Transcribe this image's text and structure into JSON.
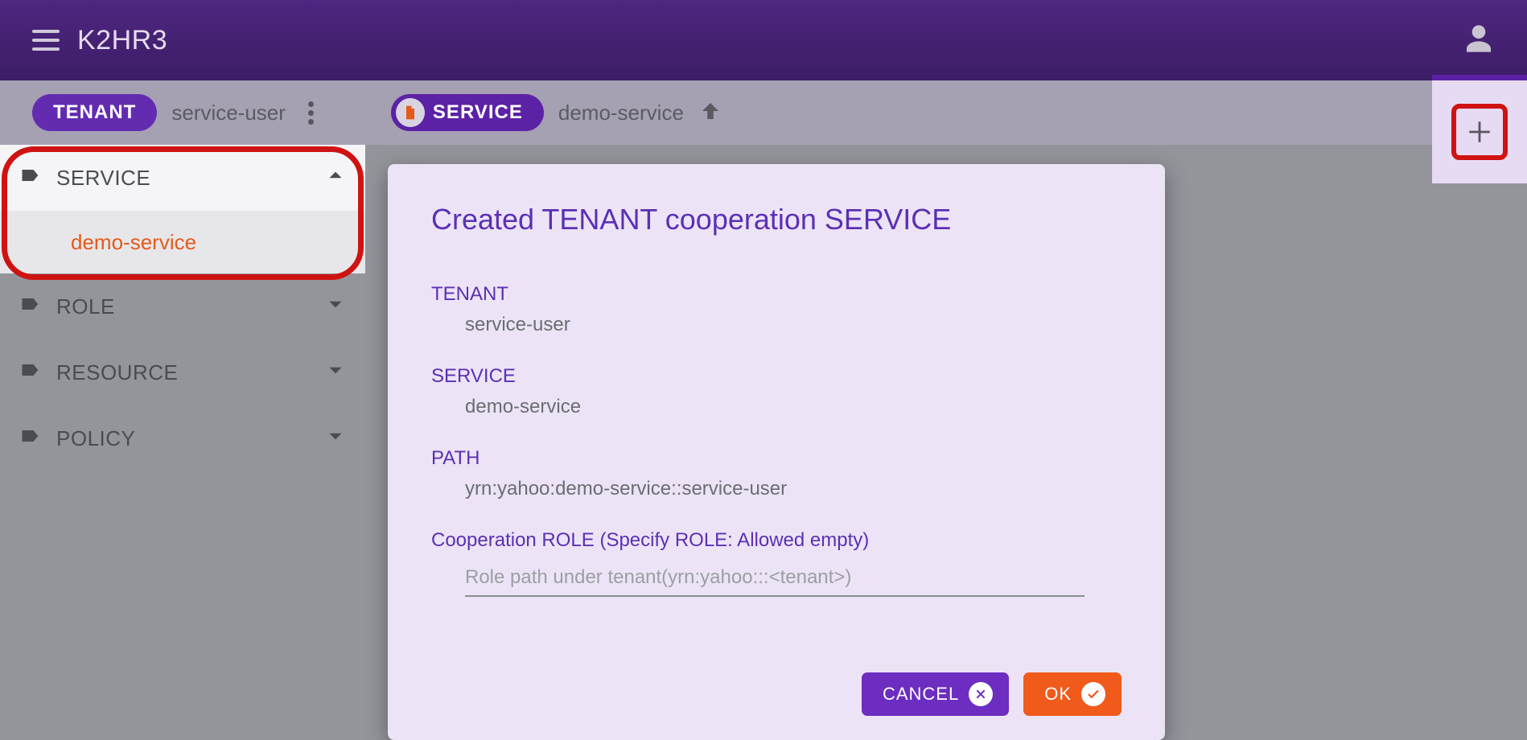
{
  "app": {
    "title": "K2HR3"
  },
  "breadcrumb": {
    "tenant_chip": "TENANT",
    "tenant_value": "service-user",
    "service_chip": "SERVICE",
    "service_value": "demo-service"
  },
  "sidebar": {
    "service": {
      "label": "SERVICE",
      "sub": "demo-service"
    },
    "role": {
      "label": "ROLE"
    },
    "resource": {
      "label": "RESOURCE"
    },
    "policy": {
      "label": "POLICY"
    }
  },
  "dialog": {
    "title": "Created TENANT cooperation SERVICE",
    "tenant_label": "TENANT",
    "tenant_value": "service-user",
    "service_label": "SERVICE",
    "service_value": "demo-service",
    "path_label": "PATH",
    "path_value": "yrn:yahoo:demo-service::service-user",
    "role_label": "Cooperation ROLE (Specify ROLE: Allowed empty)",
    "role_placeholder": "Role path under tenant(yrn:yahoo:::<tenant>)",
    "cancel": "CANCEL",
    "ok": "OK"
  }
}
